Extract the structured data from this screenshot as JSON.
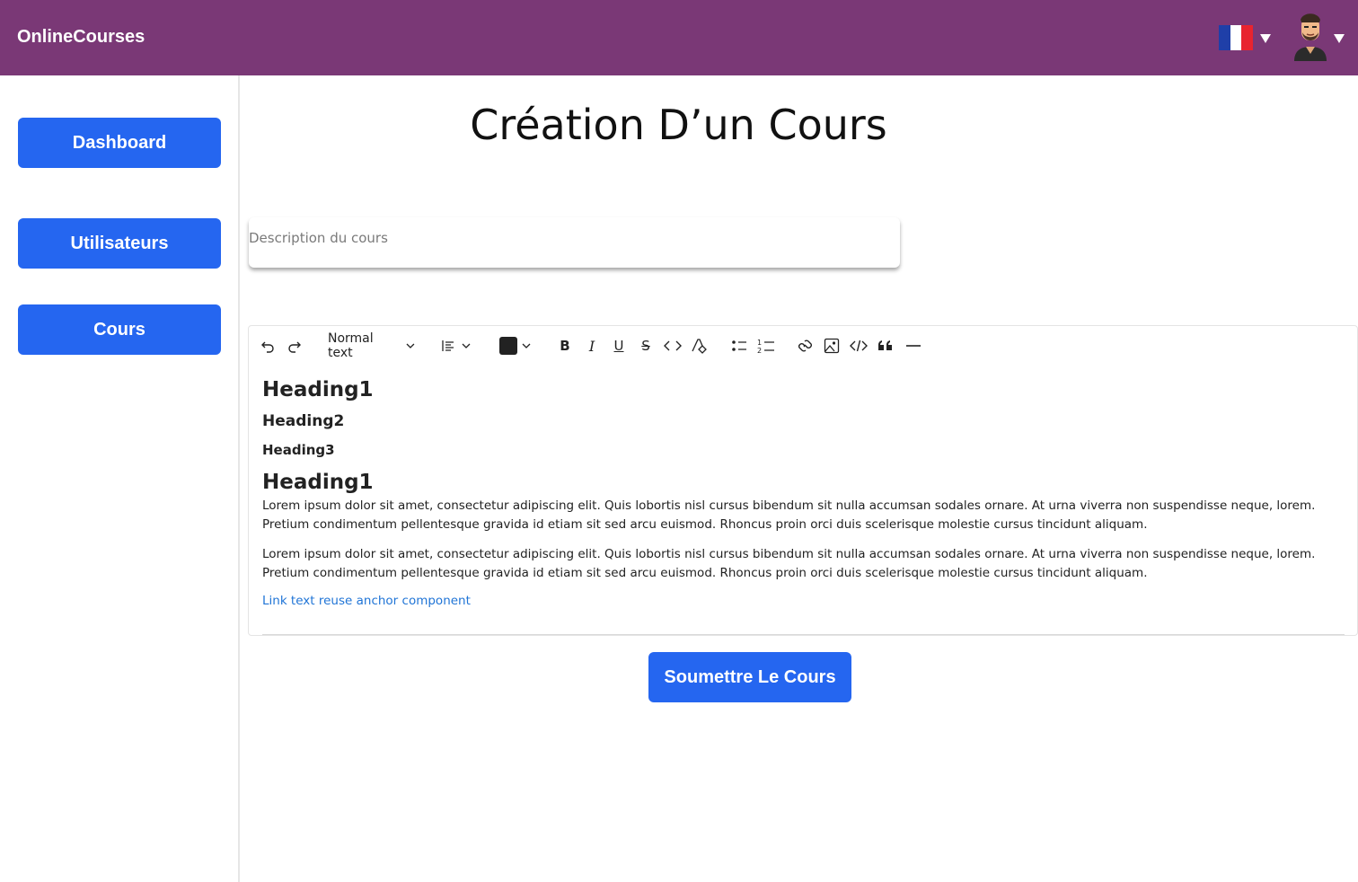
{
  "app": {
    "brand": "OnlineCourses"
  },
  "header": {
    "language_flag_colors": [
      "#1f3fa8",
      "#ffffff",
      "#e8242f"
    ],
    "language_icon": "france-flag-icon",
    "avatar_icon": "user-avatar-icon"
  },
  "sidebar": {
    "items": [
      {
        "label": "Dashboard"
      },
      {
        "label": "Utilisateurs"
      },
      {
        "label": "Cours"
      }
    ]
  },
  "main": {
    "title": "Création D’un Cours",
    "description": {
      "placeholder": "Description du cours",
      "value": ""
    },
    "editor": {
      "toolbar": {
        "block_type": "Normal text",
        "text_color": "#222222",
        "icons": [
          "undo-icon",
          "redo-icon",
          "chevron-down-icon",
          "align-icon",
          "chevron-down-icon",
          "text-color-icon",
          "chevron-down-icon",
          "bold-icon",
          "italic-icon",
          "underline-icon",
          "strikethrough-icon",
          "inline-code-icon",
          "clear-format-icon",
          "bullet-list-icon",
          "numbered-list-icon",
          "link-icon",
          "image-icon",
          "code-block-icon",
          "blockquote-icon",
          "horizontal-rule-icon"
        ]
      },
      "content": {
        "heading1": "Heading1",
        "heading2": "Heading2",
        "heading3": "Heading3",
        "heading1b": "Heading1",
        "paragraph1": "Lorem ipsum dolor sit amet, consectetur adipiscing elit. Quis lobortis nisl cursus bibendum sit nulla accumsan sodales ornare. At urna viverra non suspendisse neque, lorem. Pretium condimentum pellentesque gravida id etiam sit sed arcu euismod. Rhoncus proin orci duis scelerisque molestie cursus tincidunt aliquam.",
        "paragraph2": "Lorem ipsum dolor sit amet, consectetur adipiscing elit. Quis lobortis nisl cursus bibendum sit nulla accumsan sodales ornare. At urna viverra non suspendisse neque, lorem. Pretium condimentum pellentesque gravida id etiam sit sed arcu euismod. Rhoncus proin orci duis scelerisque molestie cursus tincidunt aliquam.",
        "link": "Link text reuse anchor component"
      }
    },
    "submit_label": "Soumettre Le Cours"
  },
  "colors": {
    "header_bg": "#7a3876",
    "primary_button": "#2566f0",
    "link": "#1f74d6"
  }
}
